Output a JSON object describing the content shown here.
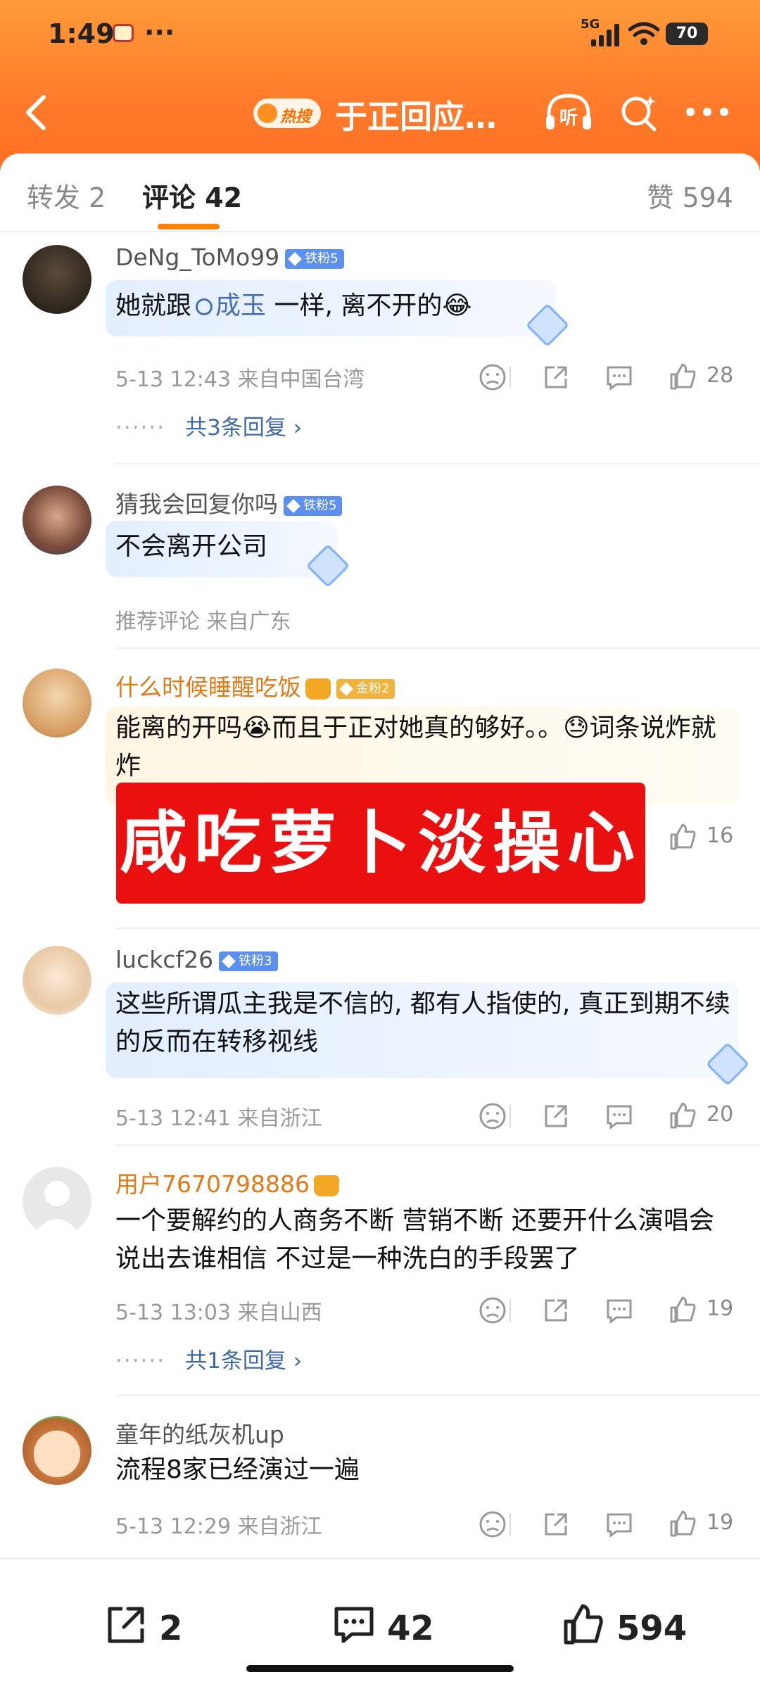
{
  "status_bar": {
    "time": "1:49",
    "dots": "···",
    "network": "5G",
    "battery": "70"
  },
  "nav": {
    "hot_badge": "热搜",
    "title": "于正回应…",
    "listen_label": "听"
  },
  "tabs": {
    "repost": "转发 2",
    "comments": "评论 42",
    "likes": "赞 594"
  },
  "comments": [
    {
      "username": "DeNg_ToMo99",
      "badge": "铁粉5",
      "text_before": "她就跟",
      "topic": "成玉",
      "text_after": " 一样, 离不开的😂",
      "meta": "5-13 12:43  来自中国台湾",
      "likes": "28",
      "replies": "共3条回复 ›"
    },
    {
      "username": "猜我会回复你吗",
      "badge": "铁粉5",
      "text": "不会离开公司",
      "meta": "推荐评论  来自广东"
    },
    {
      "username": "什么时候睡醒吃饭",
      "badge": "金粉2",
      "text": "能离的开吗😭而且于正对她真的够好。。😓词条说炸就炸",
      "banner": "咸吃萝卜淡操心",
      "likes": "16"
    },
    {
      "username": "luckcf26",
      "badge": "铁粉3",
      "text": "这些所谓瓜主我是不信的, 都有人指使的, 真正到期不续的反而在转移视线",
      "meta": "5-13 12:41  来自浙江",
      "likes": "20"
    },
    {
      "username": "用户7670798886",
      "text": "一个要解约的人商务不断 营销不断 还要开什么演唱会 说出去谁相信 不过是一种洗白的手段罢了",
      "meta": "5-13 13:03  来自山西",
      "likes": "19",
      "replies": "共1条回复 ›"
    },
    {
      "username": "童年的纸灰机up",
      "text": "流程8家已经演过一遍",
      "meta": "5-13 12:29  来自浙江",
      "likes": "19"
    }
  ],
  "bottom_bar": {
    "reposts": "2",
    "comments": "42",
    "likes": "594"
  },
  "colors": {
    "header_orange": "#ff7a2a",
    "accent": "#ff8200",
    "link_blue": "#3f6aa8",
    "banner_red": "#ea1010"
  }
}
